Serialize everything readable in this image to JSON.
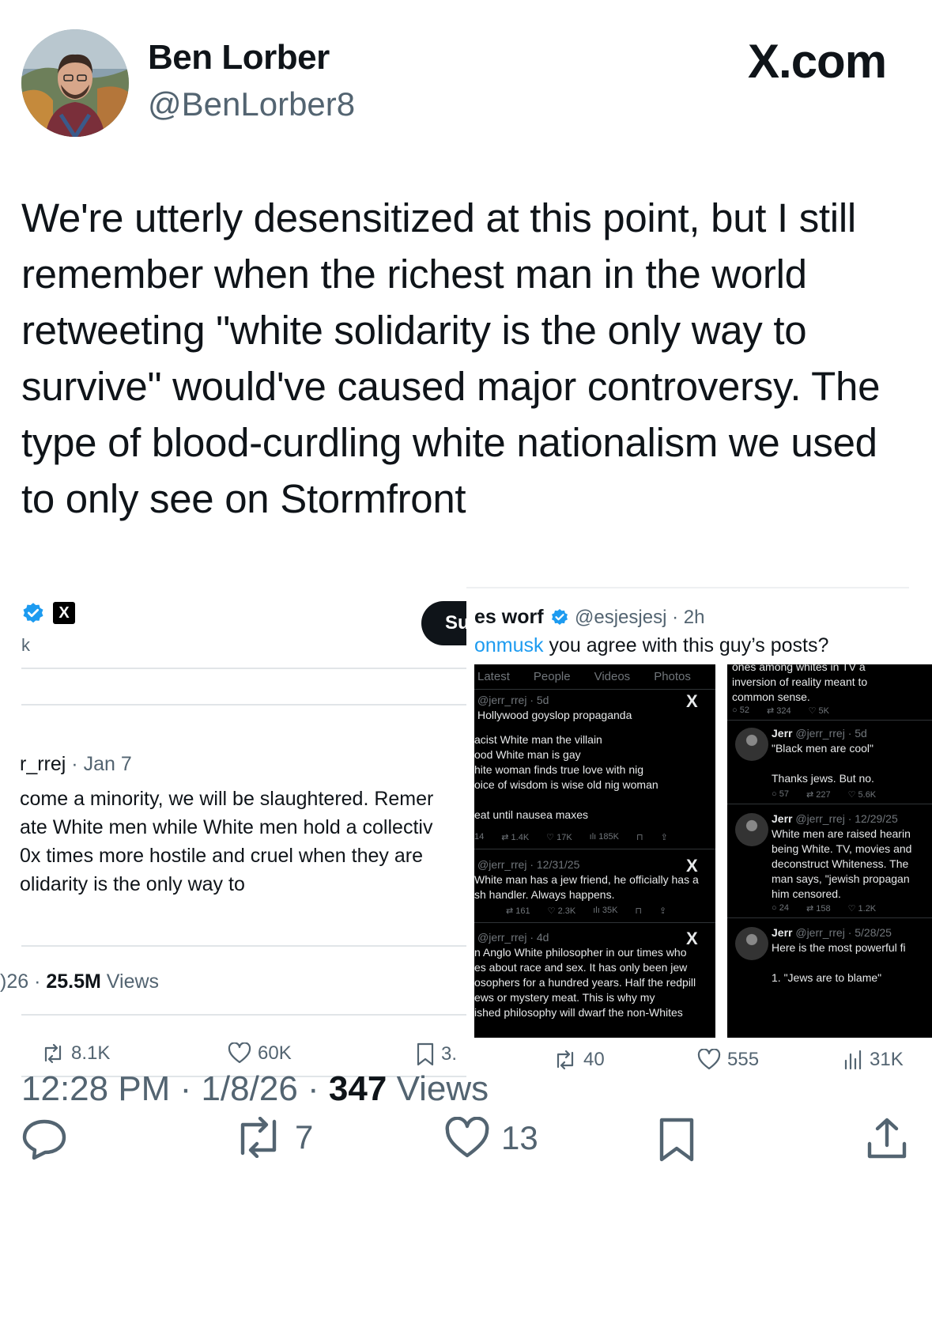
{
  "header": {
    "display_name": "Ben Lorber",
    "handle": "@BenLorber8",
    "site": "X.com"
  },
  "tweet": {
    "text": "We're utterly desensitized at this point, but I still remember when the richest man in the world retweeting \"white solidarity is the only way to survive\" would've caused major controversy. The type of blood-curdling white nationalism we used to only see on Stormfront"
  },
  "left_screenshot": {
    "badge_x": "X",
    "k_text": "k",
    "subscribe_label": "Su",
    "author_handle": "r_rrej",
    "date": "Jan 7",
    "body_lines": [
      "come a minority, we will be slaughtered. Remer",
      "ate White men while White men hold a collectiv",
      "0x times more hostile and cruel when they are",
      "olidarity is the only way to"
    ],
    "views_date": ")26",
    "views_count": "25.5M",
    "views_label": "Views",
    "retweets": "8.1K",
    "likes": "60K",
    "bookmarks": "3."
  },
  "right_screenshot": {
    "author_name": "es worf",
    "handle_time": "@esjesjesj · 2h",
    "mention": "onmusk",
    "question": " you agree with this guy’s posts?",
    "tabs": [
      "Latest",
      "People",
      "Videos",
      "Photos"
    ],
    "col1_posts": [
      {
        "handle": "@jerr_rrej · 5d",
        "lines": [
          "Hollywood goyslop propaganda"
        ]
      },
      {
        "handle": "",
        "lines": [
          "acist White man the villain",
          "ood White man is gay",
          "hite woman finds true love with nig",
          "oice of wisdom is wise old nig woman",
          "",
          "eat until nausea maxes"
        ],
        "stats": [
          "14",
          "1.4K",
          "17K",
          "185K"
        ]
      },
      {
        "handle": "@jerr_rrej · 12/31/25",
        "lines": [
          "White man has a jew friend, he officially has a",
          "sh handler. Always happens."
        ],
        "stats": [
          "161",
          "2.3K",
          "35K"
        ]
      },
      {
        "handle": "@jerr_rrej · 4d",
        "lines": [
          "n Anglo White philosopher in our times who",
          "es about race and sex. It has only been jew",
          "osophers for a hundred years. Half the redpill",
          "ews or mystery meat. This is why my",
          "ished philosophy will dwarf the non-Whites"
        ]
      }
    ],
    "col2_posts": [
      {
        "lines": [
          "ones among whites in TV a",
          "inversion of reality meant to",
          "common sense."
        ],
        "stats": [
          "52",
          "324",
          "5K"
        ]
      },
      {
        "name": "Jerr",
        "handle": "@jerr_rrej · 5d",
        "lines": [
          "\"Black men are cool\"",
          "",
          "Thanks jews. But no."
        ],
        "stats": [
          "57",
          "227",
          "5.6K"
        ]
      },
      {
        "name": "Jerr",
        "handle": "@jerr_rrej · 12/29/25",
        "lines": [
          "White men are raised hearin",
          "being White. TV, movies and",
          "deconstruct Whiteness. The",
          "man says, \"jewish propagan",
          "him censored."
        ],
        "stats": [
          "24",
          "158",
          "1.2K"
        ]
      },
      {
        "name": "Jerr",
        "handle": "@jerr_rrej · 5/28/25",
        "lines": [
          "Here is the most powerful fi",
          "",
          "1. \"Jews are to blame\""
        ]
      }
    ],
    "retweets": "40",
    "likes": "555",
    "views": "31K"
  },
  "footer": {
    "time": "12:28 PM",
    "date": "1/8/26",
    "views_count": "347",
    "views_label": "Views",
    "retweets": "7",
    "likes": "13"
  }
}
